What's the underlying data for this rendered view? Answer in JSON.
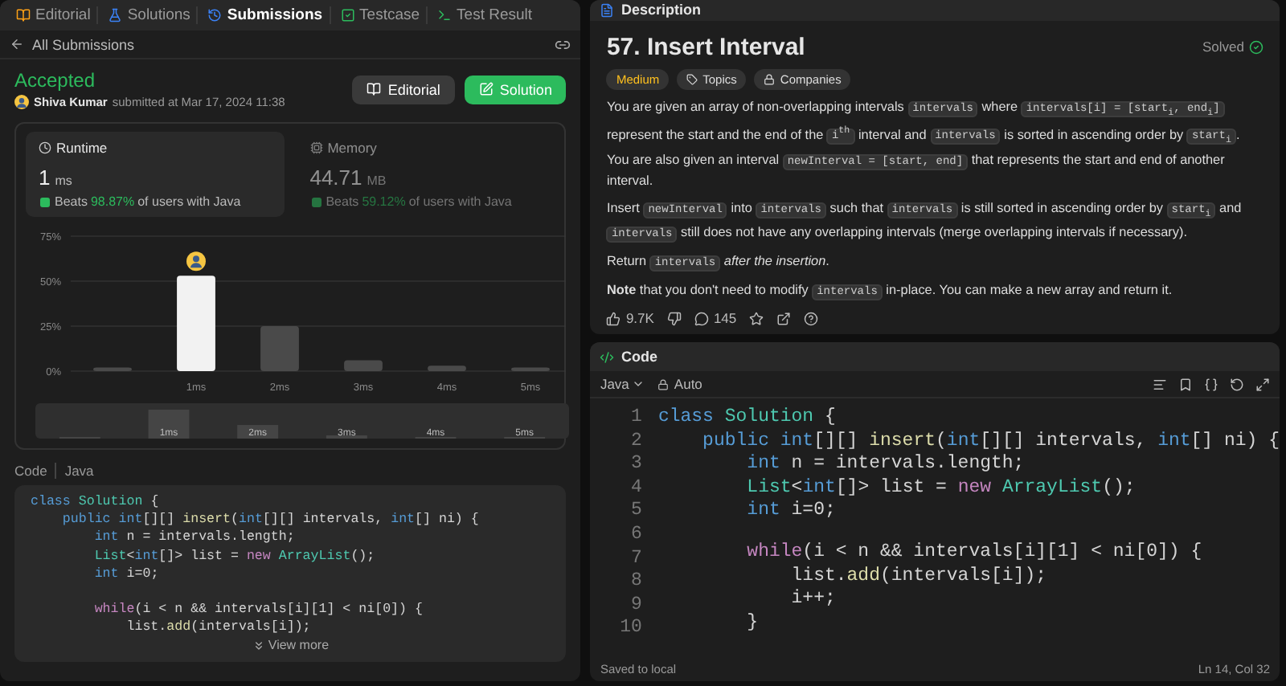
{
  "left_tabs": [
    {
      "label": "Editorial",
      "selected": false
    },
    {
      "label": "Solutions",
      "selected": false
    },
    {
      "label": "Submissions",
      "selected": true
    },
    {
      "label": "Testcase",
      "selected": false
    },
    {
      "label": "Test Result",
      "selected": false
    }
  ],
  "back_link": "All Submissions",
  "submission": {
    "status": "Accepted",
    "author": "Shiva Kumar",
    "submitted": "submitted at Mar 17, 2024 11:38",
    "buttons": [
      {
        "label": "Editorial",
        "kind": "secondary"
      },
      {
        "label": "Solution",
        "kind": "primary"
      }
    ]
  },
  "stats": [
    {
      "label": "Runtime",
      "value": "1",
      "unit": "ms",
      "beats": "Beats",
      "percent": "98.87%",
      "suffix": "of users with Java",
      "selected": true
    },
    {
      "label": "Memory",
      "value": "44.71",
      "unit": "MB",
      "beats": "Beats",
      "percent": "59.12%",
      "suffix": "of users with Java",
      "selected": false
    }
  ],
  "chart_data": {
    "type": "bar",
    "categories": [
      null,
      "1ms",
      "2ms",
      "3ms",
      "4ms",
      "5ms"
    ],
    "values": [
      2,
      53,
      25,
      6,
      3,
      2
    ],
    "ylim": [
      0,
      75
    ],
    "yticks": [
      {
        "value": 0,
        "label": "0%"
      },
      {
        "value": 25,
        "label": "25%"
      },
      {
        "value": 50,
        "label": "50%"
      },
      {
        "value": 75,
        "label": "75%"
      }
    ]
  },
  "brush_labels": [
    "1ms",
    "2ms",
    "3ms",
    "4ms",
    "5ms"
  ],
  "code_header": {
    "title": "Code",
    "language": "Java"
  },
  "left_code": [
    {
      "kind": "code",
      "tokens": [
        {
          "kind": "kw",
          "text": "class "
        },
        {
          "kind": "ty",
          "text": "Solution"
        },
        {
          "kind": "p",
          "text": " {"
        }
      ]
    },
    {
      "kind": "code",
      "tokens": [
        {
          "kind": "kw",
          "text": "    public int"
        },
        {
          "kind": "p",
          "text": "[][] "
        },
        {
          "kind": "fn",
          "text": "insert"
        },
        {
          "kind": "p",
          "text": "("
        },
        {
          "kind": "kw",
          "text": "int"
        },
        {
          "kind": "p",
          "text": "[][] intervals, "
        },
        {
          "kind": "kw",
          "text": "int"
        },
        {
          "kind": "p",
          "text": "[] ni) {"
        }
      ]
    },
    {
      "kind": "code",
      "tokens": [
        {
          "kind": "kw",
          "text": "        int"
        },
        {
          "kind": "p",
          "text": " n = intervals.length;"
        }
      ]
    },
    {
      "kind": "code",
      "tokens": [
        {
          "kind": "ty",
          "text": "        List"
        },
        {
          "kind": "p",
          "text": "<"
        },
        {
          "kind": "kw",
          "text": "int"
        },
        {
          "kind": "p",
          "text": "[]> list = "
        },
        {
          "kind": "kw2",
          "text": "new "
        },
        {
          "kind": "ty",
          "text": "ArrayList"
        },
        {
          "kind": "p",
          "text": "();"
        }
      ]
    },
    {
      "kind": "code",
      "tokens": [
        {
          "kind": "kw",
          "text": "        int"
        },
        {
          "kind": "p",
          "text": " i=0;"
        }
      ]
    },
    {
      "kind": "blank"
    },
    {
      "kind": "code",
      "tokens": [
        {
          "kind": "kw2",
          "text": "        while"
        },
        {
          "kind": "p",
          "text": "(i < n && intervals[i][1] < ni[0]) {"
        }
      ]
    },
    {
      "kind": "code",
      "tokens": [
        {
          "kind": "p",
          "text": "            list."
        },
        {
          "kind": "fn",
          "text": "add"
        },
        {
          "kind": "p",
          "text": "(intervals[i]);"
        }
      ]
    }
  ],
  "view_more": "View more",
  "description": {
    "tab": "Description",
    "title": "57. Insert Interval",
    "solved": "Solved",
    "tags": [
      {
        "label": "Medium",
        "kind": "difficulty"
      },
      {
        "label": "Topics",
        "kind": "tag"
      },
      {
        "label": "Companies",
        "kind": "lock"
      }
    ],
    "paragraphs": [
      [
        {
          "kind": "text",
          "text": "You are given an array of non-overlapping intervals "
        },
        {
          "kind": "code",
          "text": "intervals"
        },
        {
          "kind": "text",
          "text": " where "
        },
        {
          "kind": "code",
          "text": "intervals[i] = [start$_{i}$, end$_{i}$]"
        },
        {
          "kind": "text",
          "text": " represent the start and the end of the "
        },
        {
          "kind": "code",
          "text": "i$^{th}$"
        },
        {
          "kind": "text",
          "text": " interval and "
        },
        {
          "kind": "code",
          "text": "intervals"
        },
        {
          "kind": "text",
          "text": " is sorted in ascending order by "
        },
        {
          "kind": "code",
          "text": "start$_{i}$"
        },
        {
          "kind": "text",
          "text": ". You are also given an interval "
        },
        {
          "kind": "code",
          "text": "newInterval = [start, end]"
        },
        {
          "kind": "text",
          "text": " that represents the start and end of another interval."
        }
      ],
      [
        {
          "kind": "text",
          "text": "Insert "
        },
        {
          "kind": "code",
          "text": "newInterval"
        },
        {
          "kind": "text",
          "text": " into "
        },
        {
          "kind": "code",
          "text": "intervals"
        },
        {
          "kind": "text",
          "text": " such that "
        },
        {
          "kind": "code",
          "text": "intervals"
        },
        {
          "kind": "text",
          "text": " is still sorted in ascending order by "
        },
        {
          "kind": "code",
          "text": "start$_{i}$"
        },
        {
          "kind": "text",
          "text": " and "
        },
        {
          "kind": "code",
          "text": "intervals"
        },
        {
          "kind": "text",
          "text": " still does not have any overlapping intervals (merge overlapping intervals if necessary)."
        }
      ],
      [
        {
          "kind": "text",
          "text": "Return "
        },
        {
          "kind": "code",
          "text": "intervals"
        },
        {
          "kind": "text",
          "text": " *after the insertion*."
        }
      ],
      [
        {
          "kind": "text",
          "text": "**Note** that you don't need to modify "
        },
        {
          "kind": "code",
          "text": "intervals"
        },
        {
          "kind": "text",
          "text": " in-place. You can make a new array and return it."
        }
      ]
    ],
    "likes": "9.7K",
    "comments": "145"
  },
  "editor": {
    "tab": "Code",
    "language": "Java",
    "mode": "Auto",
    "status": "Saved to local",
    "position": "Ln 14, Col 32",
    "lines": [
      {
        "kind": "code",
        "tokens": [
          {
            "kind": "kw",
            "text": "class "
          },
          {
            "kind": "ty",
            "text": "Solution"
          },
          {
            "kind": "p",
            "text": " {"
          }
        ]
      },
      {
        "kind": "code",
        "tokens": [
          {
            "kind": "kw",
            "text": "    public int"
          },
          {
            "kind": "p",
            "text": "[][] "
          },
          {
            "kind": "fn",
            "text": "insert"
          },
          {
            "kind": "p",
            "text": "("
          },
          {
            "kind": "kw",
            "text": "int"
          },
          {
            "kind": "p",
            "text": "[][] intervals, "
          },
          {
            "kind": "kw",
            "text": "int"
          },
          {
            "kind": "p",
            "text": "[] ni) {"
          }
        ]
      },
      {
        "kind": "code",
        "tokens": [
          {
            "kind": "kw",
            "text": "        int"
          },
          {
            "kind": "p",
            "text": " n = intervals.length;"
          }
        ]
      },
      {
        "kind": "code",
        "tokens": [
          {
            "kind": "ty",
            "text": "        List"
          },
          {
            "kind": "p",
            "text": "<"
          },
          {
            "kind": "kw",
            "text": "int"
          },
          {
            "kind": "p",
            "text": "[]> list = "
          },
          {
            "kind": "kw2",
            "text": "new "
          },
          {
            "kind": "ty",
            "text": "ArrayList"
          },
          {
            "kind": "p",
            "text": "();"
          }
        ]
      },
      {
        "kind": "code",
        "tokens": [
          {
            "kind": "kw",
            "text": "        int"
          },
          {
            "kind": "p",
            "text": " i=0;"
          }
        ]
      },
      {
        "kind": "blank"
      },
      {
        "kind": "code",
        "tokens": [
          {
            "kind": "kw2",
            "text": "        while"
          },
          {
            "kind": "p",
            "text": "(i < n && intervals[i][1] < ni[0]) {"
          }
        ]
      },
      {
        "kind": "code",
        "tokens": [
          {
            "kind": "p",
            "text": "            list."
          },
          {
            "kind": "fn",
            "text": "add"
          },
          {
            "kind": "p",
            "text": "(intervals[i]);"
          }
        ]
      },
      {
        "kind": "code",
        "tokens": [
          {
            "kind": "p",
            "text": "            i++;"
          }
        ]
      },
      {
        "kind": "code",
        "tokens": [
          {
            "kind": "p",
            "text": "        }"
          }
        ]
      }
    ],
    "line_numbers": [
      "1",
      "2",
      "3",
      "4",
      "5",
      "6",
      "7",
      "8",
      "9",
      "10"
    ]
  }
}
